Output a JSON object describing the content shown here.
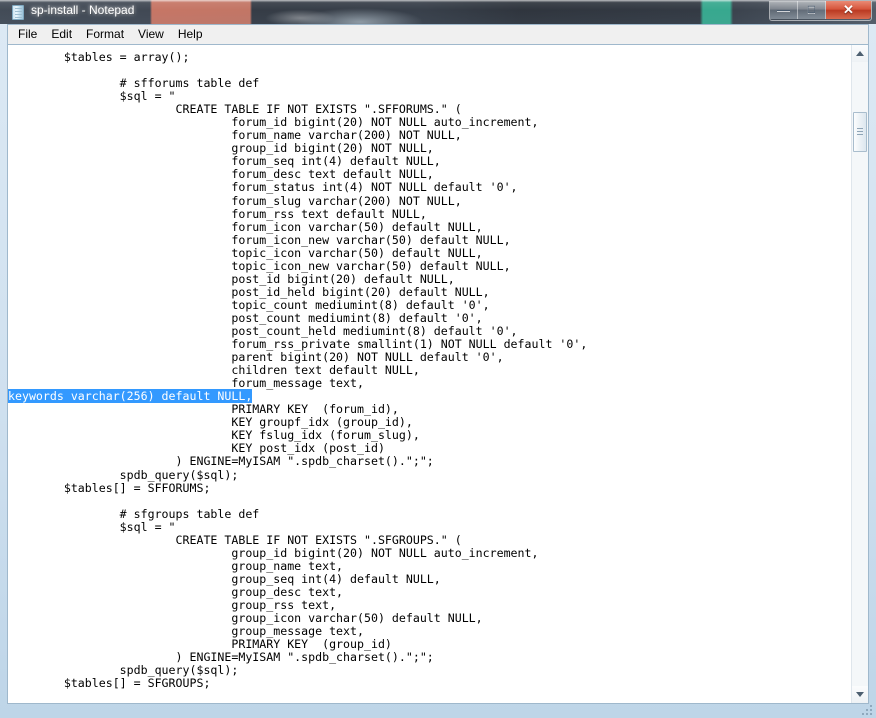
{
  "window": {
    "title": "sp-install - Notepad",
    "icon": "notepad-document-icon",
    "accent_close": "#ba3a22",
    "selection_color": "#3399ff",
    "caption_buttons": [
      {
        "name": "minimize",
        "glyph": "—"
      },
      {
        "name": "maximize",
        "glyph": "□"
      },
      {
        "name": "close",
        "glyph": "✕"
      }
    ]
  },
  "menubar": {
    "items": [
      {
        "label": "File"
      },
      {
        "label": "Edit"
      },
      {
        "label": "Format"
      },
      {
        "label": "View"
      },
      {
        "label": "Help"
      }
    ]
  },
  "editor": {
    "scrollbar": {
      "up_arrow": "scroll-up-arrow",
      "down_arrow": "scroll-down-arrow",
      "thumb_position_percent": 8
    },
    "selected_text": "keywords varchar(256) default NULL,",
    "text_before_selection": "        $tables = array();\n\n                # sfforums table def\n                $sql = \"\n                        CREATE TABLE IF NOT EXISTS \".SFFORUMS.\" (\n                                forum_id bigint(20) NOT NULL auto_increment,\n                                forum_name varchar(200) NOT NULL,\n                                group_id bigint(20) NOT NULL,\n                                forum_seq int(4) default NULL,\n                                forum_desc text default NULL,\n                                forum_status int(4) NOT NULL default '0',\n                                forum_slug varchar(200) NOT NULL,\n                                forum_rss text default NULL,\n                                forum_icon varchar(50) default NULL,\n                                forum_icon_new varchar(50) default NULL,\n                                topic_icon varchar(50) default NULL,\n                                topic_icon_new varchar(50) default NULL,\n                                post_id bigint(20) default NULL,\n                                post_id_held bigint(20) default NULL,\n                                topic_count mediumint(8) default '0',\n                                post_count mediumint(8) default '0',\n                                post_count_held mediumint(8) default '0',\n                                forum_rss_private smallint(1) NOT NULL default '0',\n                                parent bigint(20) NOT NULL default '0',\n                                children text default NULL,\n                                forum_message text,\n",
    "text_after_selection": "\n                                PRIMARY KEY  (forum_id),\n                                KEY groupf_idx (group_id),\n                                KEY fslug_idx (forum_slug),\n                                KEY post_idx (post_id)\n                        ) ENGINE=MyISAM \".spdb_charset().\";\";\n                spdb_query($sql);\n        $tables[] = SFFORUMS;\n\n                # sfgroups table def\n                $sql = \"\n                        CREATE TABLE IF NOT EXISTS \".SFGROUPS.\" (\n                                group_id bigint(20) NOT NULL auto_increment,\n                                group_name text,\n                                group_seq int(4) default NULL,\n                                group_desc text,\n                                group_rss text,\n                                group_icon varchar(50) default NULL,\n                                group_message text,\n                                PRIMARY KEY  (group_id)\n                        ) ENGINE=MyISAM \".spdb_charset().\";\";\n                spdb_query($sql);\n        $tables[] = SFGROUPS;"
  }
}
